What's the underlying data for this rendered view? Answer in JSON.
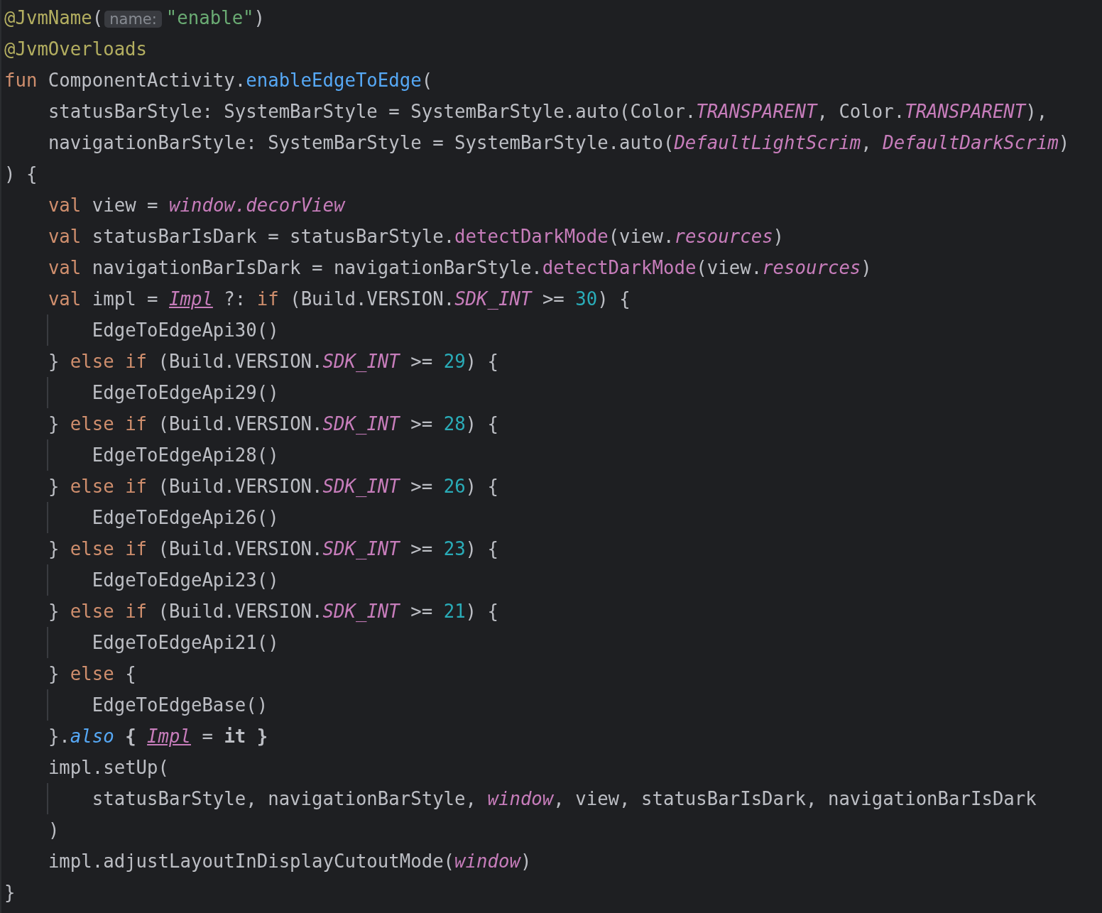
{
  "editor": {
    "lines": [
      {
        "kind": "top",
        "tokens": [
          {
            "kind": "annotation",
            "text": "@JvmName"
          },
          {
            "kind": "plain",
            "text": "("
          },
          {
            "kind": "hint",
            "text": "name:"
          },
          {
            "kind": "string",
            "text": "\"enable\""
          },
          {
            "kind": "plain",
            "text": ")"
          }
        ]
      },
      {
        "kind": "top",
        "tokens": [
          {
            "kind": "annotation",
            "text": "@JvmOverloads"
          }
        ]
      },
      {
        "kind": "top",
        "tokens": [
          {
            "kind": "keyword",
            "text": "fun"
          },
          {
            "kind": "plain",
            "text": " ComponentActivity."
          },
          {
            "kind": "call",
            "text": "enableEdgeToEdge"
          },
          {
            "kind": "plain",
            "text": "("
          }
        ]
      },
      {
        "kind": "body",
        "tokens": [
          {
            "kind": "plain",
            "text": "statusBarStyle: SystemBarStyle = SystemBarStyle.auto(Color."
          },
          {
            "kind": "member",
            "text": "TRANSPARENT"
          },
          {
            "kind": "plain",
            "text": ", Color."
          },
          {
            "kind": "member",
            "text": "TRANSPARENT"
          },
          {
            "kind": "plain",
            "text": "),"
          }
        ]
      },
      {
        "kind": "body",
        "tokens": [
          {
            "kind": "plain",
            "text": "navigationBarStyle: SystemBarStyle = SystemBarStyle.auto("
          },
          {
            "kind": "member",
            "text": "DefaultLightScrim"
          },
          {
            "kind": "plain",
            "text": ", "
          },
          {
            "kind": "member",
            "text": "DefaultDarkScrim"
          },
          {
            "kind": "plain",
            "text": ")"
          }
        ]
      },
      {
        "kind": "top",
        "tokens": [
          {
            "kind": "plain",
            "text": ") {"
          }
        ]
      },
      {
        "kind": "body",
        "tokens": [
          {
            "kind": "keyword",
            "text": "val"
          },
          {
            "kind": "plain",
            "text": " view = "
          },
          {
            "kind": "member",
            "text": "window"
          },
          {
            "kind": "member",
            "text": ".decorView"
          }
        ]
      },
      {
        "kind": "body",
        "tokens": [
          {
            "kind": "keyword",
            "text": "val"
          },
          {
            "kind": "plain",
            "text": " statusBarIsDark = statusBarStyle."
          },
          {
            "kind": "extension",
            "text": "detectDarkMode"
          },
          {
            "kind": "plain",
            "text": "(view."
          },
          {
            "kind": "member",
            "text": "resources"
          },
          {
            "kind": "plain",
            "text": ")"
          }
        ]
      },
      {
        "kind": "body",
        "tokens": [
          {
            "kind": "keyword",
            "text": "val"
          },
          {
            "kind": "plain",
            "text": " navigationBarIsDark = navigationBarStyle."
          },
          {
            "kind": "extension",
            "text": "detectDarkMode"
          },
          {
            "kind": "plain",
            "text": "(view."
          },
          {
            "kind": "member",
            "text": "resources"
          },
          {
            "kind": "plain",
            "text": ")"
          }
        ]
      },
      {
        "kind": "body",
        "tokens": [
          {
            "kind": "keyword",
            "text": "val"
          },
          {
            "kind": "plain",
            "text": " impl = "
          },
          {
            "kind": "mutable",
            "text": "Impl"
          },
          {
            "kind": "plain",
            "text": " ?: "
          },
          {
            "kind": "keyword",
            "text": "if"
          },
          {
            "kind": "plain",
            "text": " (Build.VERSION."
          },
          {
            "kind": "member",
            "text": "SDK_INT"
          },
          {
            "kind": "plain",
            "text": " >= "
          },
          {
            "kind": "number",
            "text": "30"
          },
          {
            "kind": "plain",
            "text": ") {"
          }
        ]
      },
      {
        "kind": "nested",
        "tokens": [
          {
            "kind": "plain",
            "text": "EdgeToEdgeApi30()"
          }
        ]
      },
      {
        "kind": "body",
        "tokens": [
          {
            "kind": "plain",
            "text": "} "
          },
          {
            "kind": "keyword",
            "text": "else if"
          },
          {
            "kind": "plain",
            "text": " (Build.VERSION."
          },
          {
            "kind": "member",
            "text": "SDK_INT"
          },
          {
            "kind": "plain",
            "text": " >= "
          },
          {
            "kind": "number",
            "text": "29"
          },
          {
            "kind": "plain",
            "text": ") {"
          }
        ]
      },
      {
        "kind": "nested",
        "tokens": [
          {
            "kind": "plain",
            "text": "EdgeToEdgeApi29()"
          }
        ]
      },
      {
        "kind": "body",
        "tokens": [
          {
            "kind": "plain",
            "text": "} "
          },
          {
            "kind": "keyword",
            "text": "else if"
          },
          {
            "kind": "plain",
            "text": " (Build.VERSION."
          },
          {
            "kind": "member",
            "text": "SDK_INT"
          },
          {
            "kind": "plain",
            "text": " >= "
          },
          {
            "kind": "number",
            "text": "28"
          },
          {
            "kind": "plain",
            "text": ") {"
          }
        ]
      },
      {
        "kind": "nested",
        "tokens": [
          {
            "kind": "plain",
            "text": "EdgeToEdgeApi28()"
          }
        ]
      },
      {
        "kind": "body",
        "tokens": [
          {
            "kind": "plain",
            "text": "} "
          },
          {
            "kind": "keyword",
            "text": "else if"
          },
          {
            "kind": "plain",
            "text": " (Build.VERSION."
          },
          {
            "kind": "member",
            "text": "SDK_INT"
          },
          {
            "kind": "plain",
            "text": " >= "
          },
          {
            "kind": "number",
            "text": "26"
          },
          {
            "kind": "plain",
            "text": ") {"
          }
        ]
      },
      {
        "kind": "nested",
        "tokens": [
          {
            "kind": "plain",
            "text": "EdgeToEdgeApi26()"
          }
        ]
      },
      {
        "kind": "body",
        "tokens": [
          {
            "kind": "plain",
            "text": "} "
          },
          {
            "kind": "keyword",
            "text": "else if"
          },
          {
            "kind": "plain",
            "text": " (Build.VERSION."
          },
          {
            "kind": "member",
            "text": "SDK_INT"
          },
          {
            "kind": "plain",
            "text": " >= "
          },
          {
            "kind": "number",
            "text": "23"
          },
          {
            "kind": "plain",
            "text": ") {"
          }
        ]
      },
      {
        "kind": "nested",
        "tokens": [
          {
            "kind": "plain",
            "text": "EdgeToEdgeApi23()"
          }
        ]
      },
      {
        "kind": "body",
        "tokens": [
          {
            "kind": "plain",
            "text": "} "
          },
          {
            "kind": "keyword",
            "text": "else if"
          },
          {
            "kind": "plain",
            "text": " (Build.VERSION."
          },
          {
            "kind": "member",
            "text": "SDK_INT"
          },
          {
            "kind": "plain",
            "text": " >= "
          },
          {
            "kind": "number",
            "text": "21"
          },
          {
            "kind": "plain",
            "text": ") {"
          }
        ]
      },
      {
        "kind": "nested",
        "tokens": [
          {
            "kind": "plain",
            "text": "EdgeToEdgeApi21()"
          }
        ]
      },
      {
        "kind": "body",
        "tokens": [
          {
            "kind": "plain",
            "text": "} "
          },
          {
            "kind": "keyword",
            "text": "else"
          },
          {
            "kind": "plain",
            "text": " {"
          }
        ]
      },
      {
        "kind": "nested",
        "tokens": [
          {
            "kind": "plain",
            "text": "EdgeToEdgeBase()"
          }
        ]
      },
      {
        "kind": "body",
        "tokens": [
          {
            "kind": "plain",
            "text": "}."
          },
          {
            "kind": "italic-call",
            "text": "also"
          },
          {
            "kind": "bold",
            "text": " { "
          },
          {
            "kind": "mutable",
            "text": "Impl"
          },
          {
            "kind": "plain",
            "text": " = "
          },
          {
            "kind": "bold",
            "text": "it }"
          }
        ]
      },
      {
        "kind": "body",
        "tokens": [
          {
            "kind": "plain",
            "text": "impl.setUp("
          }
        ]
      },
      {
        "kind": "nested",
        "tokens": [
          {
            "kind": "plain",
            "text": "statusBarStyle, navigationBarStyle, "
          },
          {
            "kind": "member",
            "text": "window"
          },
          {
            "kind": "plain",
            "text": ", view, statusBarIsDark, navigationBarIsDark"
          }
        ]
      },
      {
        "kind": "body",
        "tokens": [
          {
            "kind": "plain",
            "text": ")"
          }
        ]
      },
      {
        "kind": "body",
        "tokens": [
          {
            "kind": "plain",
            "text": "impl.adjustLayoutInDisplayCutoutMode("
          },
          {
            "kind": "member",
            "text": "window"
          },
          {
            "kind": "plain",
            "text": ")"
          }
        ]
      },
      {
        "kind": "top",
        "tokens": [
          {
            "kind": "plain",
            "text": "}"
          }
        ]
      }
    ]
  }
}
